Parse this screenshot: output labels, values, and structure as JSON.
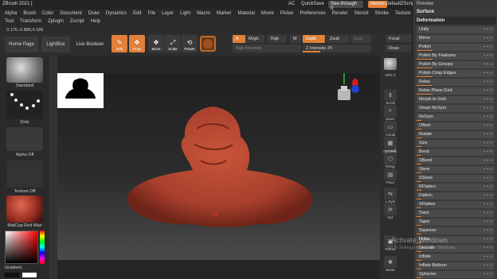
{
  "titlebar": {
    "title": "ZBrush 2021 [",
    "ac": "AC",
    "quicksave": "QuickSave",
    "see_through": "See-through",
    "see_value": "0",
    "menus": "Menus",
    "default_script": "DefaultZScript"
  },
  "menu": {
    "row1": [
      "Alpha",
      "Brush",
      "Color",
      "Document",
      "Draw",
      "Dynamics",
      "Edit",
      "File",
      "Layer",
      "Light",
      "Macro",
      "Marker",
      "Material",
      "Movie",
      "Picker",
      "Preferences",
      "Render",
      "Stencil",
      "Stroke",
      "Texture"
    ],
    "row2": [
      "Tool",
      "Transform",
      "Zplugin",
      "Zscript",
      "Help"
    ]
  },
  "coords": "0.176,-0.886,4.189",
  "toolbar": {
    "home_page": "Home Page",
    "lightbox": "LightBox",
    "live_boolean": "Live Boolean",
    "edit": "Edit",
    "draw": "Draw",
    "move": "Move",
    "scale": "Scale",
    "rotate": "Rotate",
    "a": "A",
    "mrgb": "Mrgb",
    "rgb": "Rgb",
    "m": "M",
    "zadd": "Zadd",
    "zsub": "Zsub",
    "zcut": "Zcut",
    "rgb_intensity": "Rgb Intensity",
    "z_intensity": "Z Intensity 25",
    "z_intensity_value": 0.25,
    "focal": "Focal",
    "draw_size": "Draw"
  },
  "leftshelf": {
    "brush": "Standard",
    "stroke": "Dots",
    "alpha": "Alpha Off",
    "texture": "Texture Off",
    "material": "MatCap Red Wax",
    "gradient": "Gradient"
  },
  "rightstrip": {
    "spix": "SPix 3",
    "buttons": [
      "Scroll",
      "Zoom",
      "Actual",
      "AAHalf",
      "Persp",
      "Floor",
      "L.Sym",
      "Xyz",
      "Frame",
      "Move"
    ],
    "dynamic": "Dynamic"
  },
  "rightpanel": {
    "preview": "Preview",
    "surface": "Surface",
    "deformation": "Deformation",
    "items": [
      "Unify",
      "Mirror",
      "Polish",
      "Polish By Features",
      "Polish By Groups",
      "Polish Crisp Edges",
      "Relax",
      "Relax Plane Grid",
      "Morph to Grid",
      "Smart ReSym",
      "ReSym",
      "Offset",
      "Rotate",
      "Size",
      "Bend",
      "SBend",
      "Skew",
      "SSkew",
      "RFlatten",
      "Flatten",
      "SFlatten",
      "Twist",
      "Taper",
      "Squeeze",
      "Noise",
      "Smooth",
      "Inflate",
      "Inflate Balloon",
      "Spherize"
    ]
  },
  "watermark": {
    "title": "Activate Windows",
    "subtitle": "Go to Settings to activate Windows."
  },
  "colors": {
    "accent": "#e0803a",
    "mesh": "#b4432e",
    "panel": "#3a3a3a"
  }
}
